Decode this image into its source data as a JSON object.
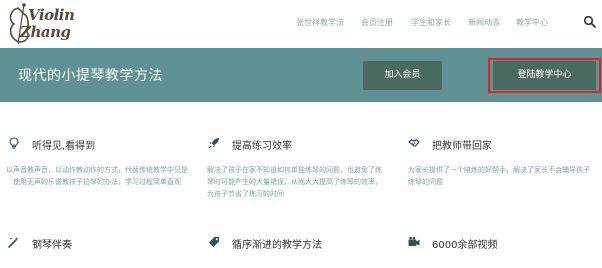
{
  "logo": {
    "line1": "Violin",
    "line2": "Zhang"
  },
  "nav": {
    "items": [
      "张世祥教学法",
      "会员注册",
      "学生和家长",
      "新闻动态",
      "教学中心"
    ]
  },
  "banner": {
    "title": "现代的小提琴教学方法",
    "join_label": "加入会员",
    "login_label": "登陆教学中心"
  },
  "features": [
    {
      "icon": "lightbulb-icon",
      "title": "听得见,看得到",
      "desc": "以声音教声音，以动作教动作的方式，代替传统教学中只是使用无声的乐谱教孩子拉琴的办法，学习过程简单直观"
    },
    {
      "icon": "rocket-icon",
      "title": "提高练习效率",
      "desc": "解决了孩子在家不知道如何单独练琴的问题，也避免了练琴时可能产生的大量错误，从而大大提高了练琴的效率，为孩子节省了练习的时间"
    },
    {
      "icon": "handshake-icon",
      "title": "把教师带回家",
      "desc": "为家长提供了一个陪练的好帮手，解决了家长不会辅导孩子练琴的问题"
    },
    {
      "icon": "magic-wand-icon",
      "title": "钢琴伴奏"
    },
    {
      "icon": "tag-icon",
      "title": "循序渐进的教学方法"
    },
    {
      "icon": "video-camera-icon",
      "title": "6000余部视频"
    }
  ],
  "colors": {
    "banner": "#5f9195",
    "button": "#4b6a62",
    "highlight": "#e0232a",
    "nav_text": "#8fa8ab",
    "desc_text": "#7aa4a8"
  }
}
